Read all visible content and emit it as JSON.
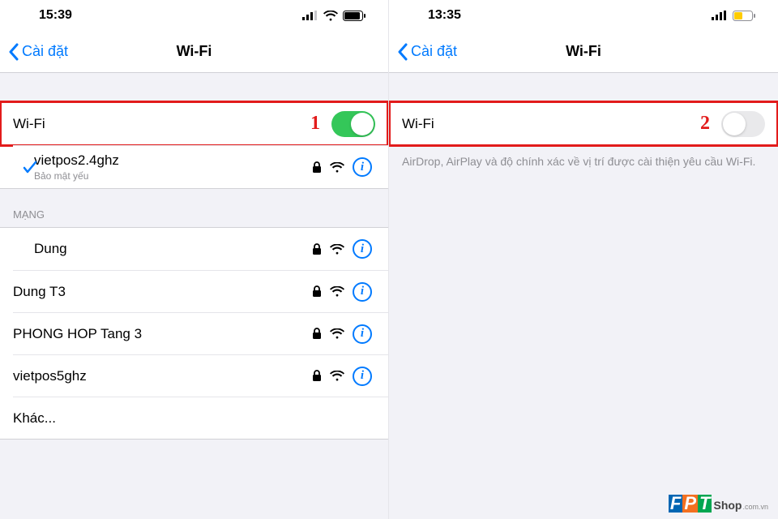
{
  "left": {
    "status": {
      "time": "15:39"
    },
    "nav": {
      "back": "Cài đặt",
      "title": "Wi-Fi"
    },
    "wifi_row": {
      "label": "Wi-Fi",
      "callout": "1",
      "toggle_on": true
    },
    "connected": {
      "ssid": "vietpos2.4ghz",
      "security_note": "Bảo mật yếu"
    },
    "section_header": "MẠNG",
    "networks": [
      {
        "ssid": "Dung"
      },
      {
        "ssid": "Dung T3"
      },
      {
        "ssid": "PHONG HOP Tang 3"
      },
      {
        "ssid": "vietpos5ghz"
      }
    ],
    "other": "Khác..."
  },
  "right": {
    "status": {
      "time": "13:35"
    },
    "nav": {
      "back": "Cài đặt",
      "title": "Wi-Fi"
    },
    "wifi_row": {
      "label": "Wi-Fi",
      "callout": "2",
      "toggle_on": false
    },
    "description": "AirDrop, AirPlay và độ chính xác về vị trí được cài thiện yêu cầu Wi-Fi."
  },
  "watermark": {
    "brand": "FPT",
    "shop": "Shop",
    "suffix": ".com.vn"
  }
}
